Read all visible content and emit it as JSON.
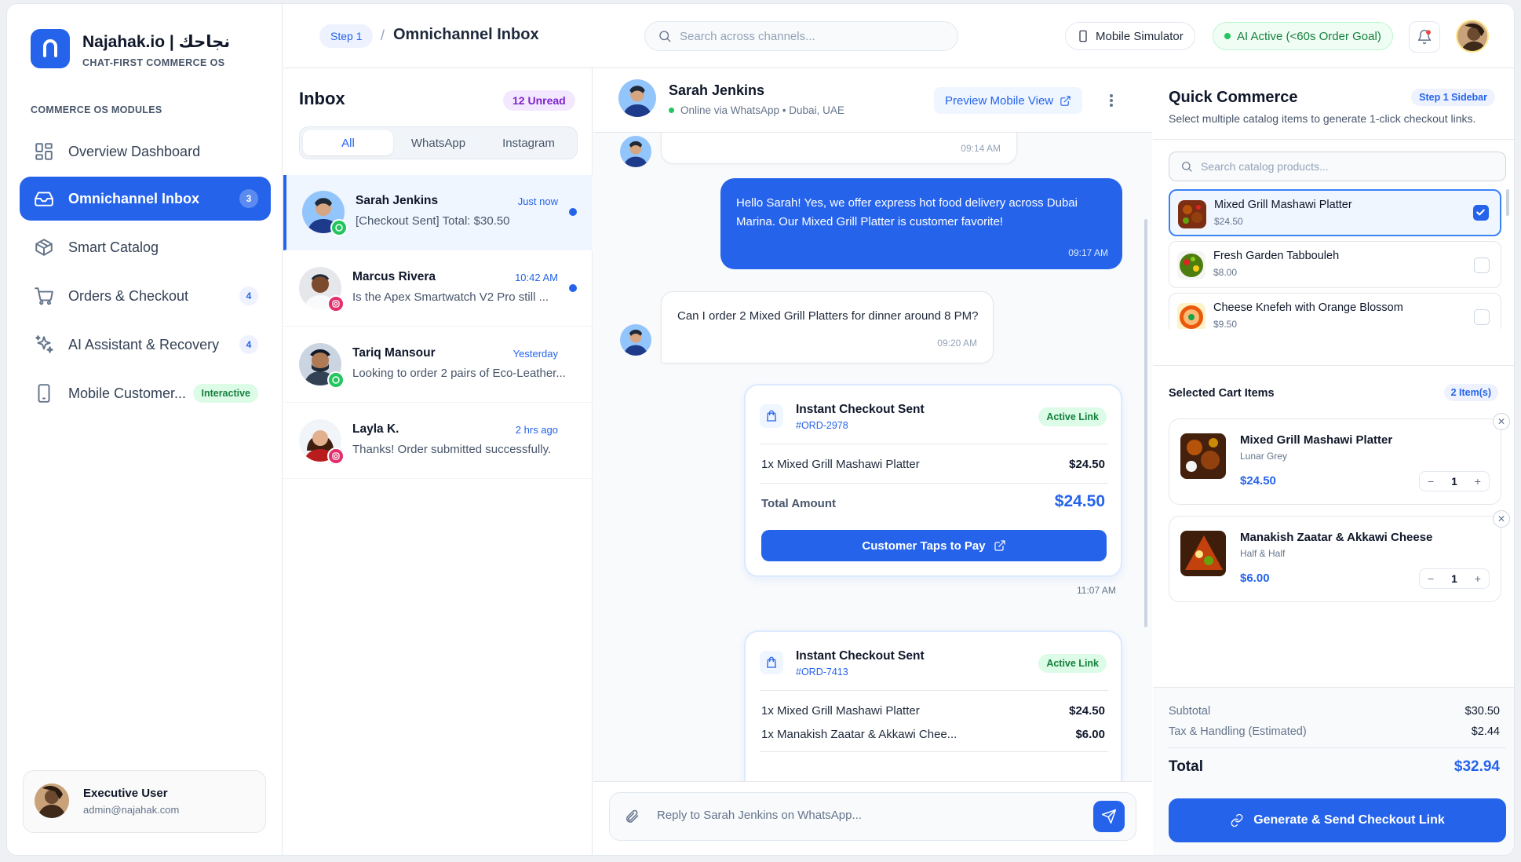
{
  "brand": {
    "name": "Najahak.io | نجاحك",
    "tagline": "CHAT-FIRST COMMERCE OS"
  },
  "sidebar": {
    "section_title": "COMMERCE OS MODULES",
    "items": [
      {
        "label": "Overview Dashboard",
        "icon": "grid-icon"
      },
      {
        "label": "Omnichannel Inbox",
        "icon": "inbox-icon",
        "badge": "3",
        "active": true
      },
      {
        "label": "Smart Catalog",
        "icon": "package-icon"
      },
      {
        "label": "Orders & Checkout",
        "icon": "cart-icon",
        "badge": "4"
      },
      {
        "label": "AI Assistant & Recovery",
        "icon": "sparkles-icon",
        "badge": "4"
      },
      {
        "label": "Mobile Customer...",
        "icon": "phone-icon",
        "pill": "Interactive"
      }
    ],
    "user": {
      "name": "Executive User",
      "email": "admin@najahak.com"
    }
  },
  "header": {
    "step": "Step 1",
    "separator": "/",
    "title": "Omnichannel Inbox",
    "search_placeholder": "Search across channels...",
    "mobile_button": "Mobile Simulator",
    "ai_status": "AI Active (<60s Order Goal)"
  },
  "inbox": {
    "title": "Inbox",
    "unread": "12 Unread",
    "tabs": [
      "All",
      "WhatsApp",
      "Instagram"
    ],
    "conversations": [
      {
        "name": "Sarah Jenkins",
        "time": "Just now",
        "preview": "[Checkout Sent] Total: $30.50",
        "channel": "whatsapp",
        "unread": true
      },
      {
        "name": "Marcus Rivera",
        "time": "10:42 AM",
        "preview": "Is the Apex Smartwatch V2 Pro still ...",
        "channel": "instagram",
        "unread": true
      },
      {
        "name": "Tariq Mansour",
        "time": "Yesterday",
        "preview": "Looking to order 2 pairs of Eco-Leather...",
        "channel": "whatsapp",
        "unread": false
      },
      {
        "name": "Layla K.",
        "time": "2 hrs ago",
        "preview": "Thanks! Order submitted successfully.",
        "channel": "instagram",
        "unread": false
      }
    ]
  },
  "chat": {
    "contact_name": "Sarah Jenkins",
    "contact_status": "Online via WhatsApp • Dubai, UAE",
    "preview_button": "Preview Mobile View",
    "messages": [
      {
        "time": "09:14 AM"
      },
      {
        "text": "Hello Sarah! Yes, we offer express hot food delivery across Dubai Marina. Our Mixed Grill Platter is customer favorite!",
        "time": "09:17 AM"
      },
      {
        "text": "Can I order 2 Mixed Grill Platters for dinner around 8 PM?",
        "time": "09:20 AM"
      }
    ],
    "checkouts": [
      {
        "title": "Instant Checkout Sent",
        "order": "#ORD-2978",
        "status": "Active Link",
        "lines": [
          {
            "item": "1x Mixed Grill Mashawi Platter",
            "price": "$24.50"
          }
        ],
        "total_label": "Total Amount",
        "total": "$24.50",
        "button": "Customer Taps to Pay",
        "time": "11:07 AM"
      },
      {
        "title": "Instant Checkout Sent",
        "order": "#ORD-7413",
        "status": "Active Link",
        "lines": [
          {
            "item": "1x Mixed Grill Mashawi Platter",
            "price": "$24.50"
          },
          {
            "item": "1x Manakish Zaatar & Akkawi Chee...",
            "price": "$6.00"
          }
        ]
      }
    ],
    "composer_placeholder": "Reply to Sarah Jenkins on WhatsApp..."
  },
  "quick": {
    "title": "Quick Commerce",
    "step_badge": "Step 1 Sidebar",
    "subtitle": "Select multiple catalog items to generate 1-click checkout links.",
    "search_placeholder": "Search catalog products...",
    "catalog": [
      {
        "name": "Mixed Grill Mashawi Platter",
        "price": "$24.50",
        "checked": true
      },
      {
        "name": "Fresh Garden Tabbouleh",
        "price": "$8.00",
        "checked": false
      },
      {
        "name": "Cheese Knefeh with Orange Blossom",
        "price": "$9.50",
        "checked": false
      }
    ],
    "cart_title": "Selected Cart Items",
    "cart_count": "2 Item(s)",
    "cart": [
      {
        "name": "Mixed Grill Mashawi Platter",
        "variant": "Lunar Grey",
        "price": "$24.50",
        "qty": "1"
      },
      {
        "name": "Manakish Zaatar & Akkawi Cheese",
        "variant": "Half & Half",
        "price": "$6.00",
        "qty": "1"
      }
    ],
    "summary": {
      "subtotal_label": "Subtotal",
      "subtotal": "$30.50",
      "tax_label": "Tax & Handling (Estimated)",
      "tax": "$2.44",
      "total_label": "Total",
      "total": "$32.94"
    },
    "generate_button": "Generate & Send Checkout Link"
  },
  "colors": {
    "accent": "#2563eb",
    "success": "#15803d",
    "instagram": "#e1306c",
    "whatsapp": "#22c55e"
  }
}
